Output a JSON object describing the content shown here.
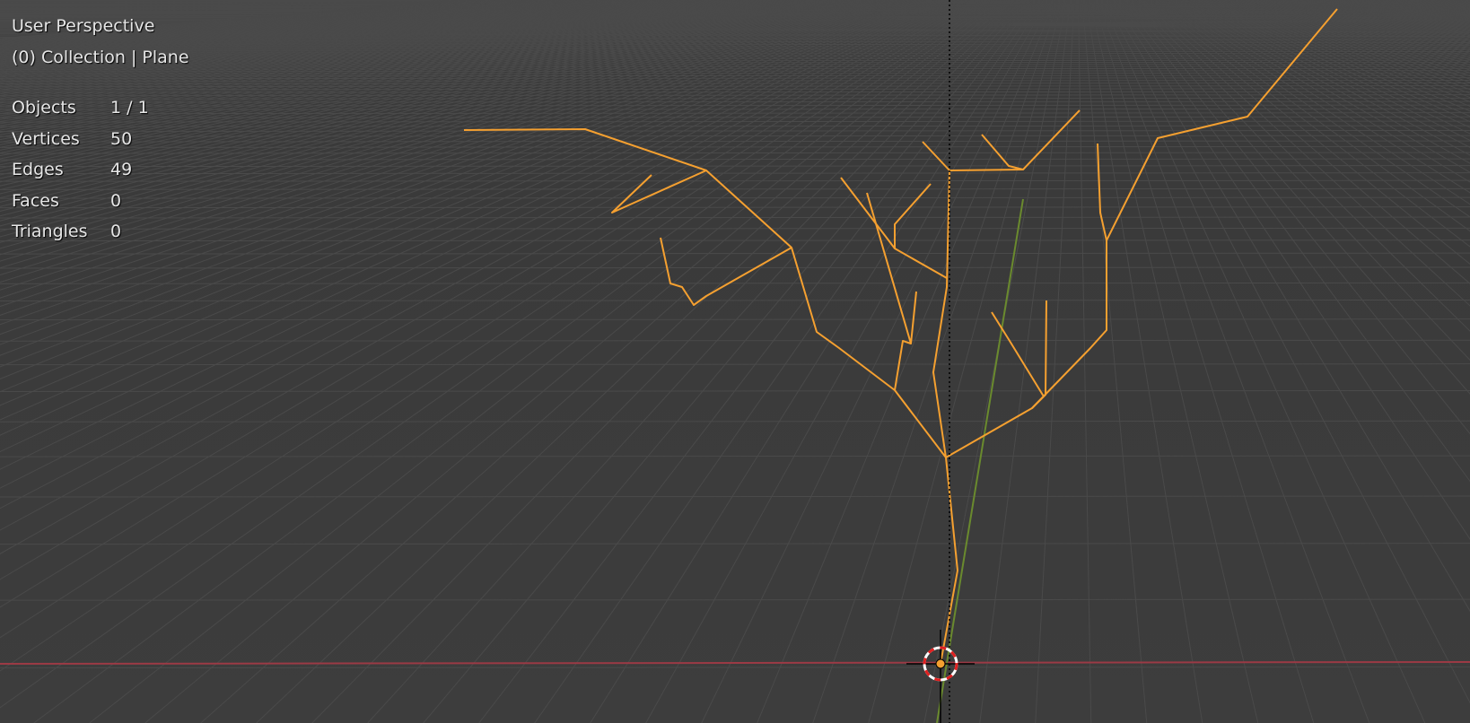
{
  "viewport": {
    "view_name": "User Perspective",
    "collection_info": "(0) Collection | Plane",
    "stats": [
      {
        "label": "Objects",
        "value": "1 / 1"
      },
      {
        "label": "Vertices",
        "value": "50"
      },
      {
        "label": "Edges",
        "value": "49"
      },
      {
        "label": "Faces",
        "value": "0"
      },
      {
        "label": "Triangles",
        "value": "0"
      }
    ],
    "colors": {
      "background": "#3a3a3a",
      "grid": "#4a4a4a",
      "x_axis": "#9b3a45",
      "y_axis": "#6a8a2e",
      "selected_edges": "#f5a030",
      "cursor_red": "#e02020"
    },
    "icons": [
      "3d-cursor-icon",
      "object-origin-icon"
    ]
  }
}
